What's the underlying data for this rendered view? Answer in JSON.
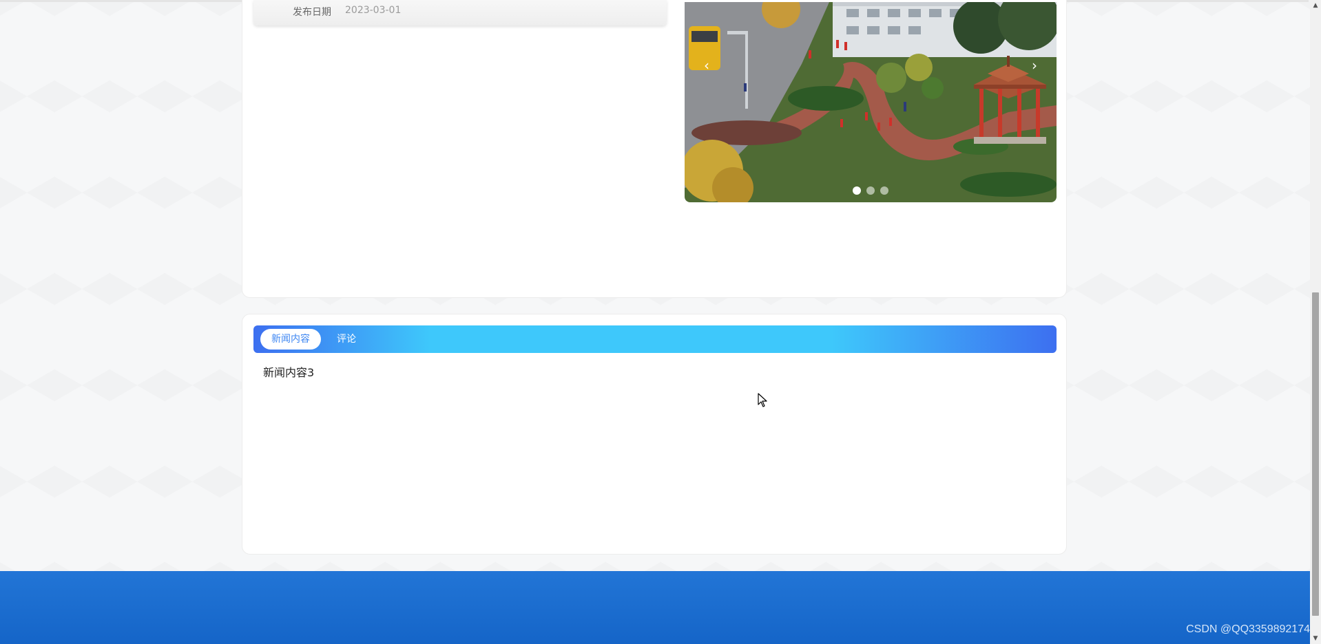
{
  "news_detail": {
    "publish_date_label": "发布日期",
    "publish_date_value": "2023-03-01"
  },
  "carousel": {
    "prev_icon": "‹",
    "next_icon": "›",
    "slide_count": 3,
    "active_slide": 1
  },
  "tabs": {
    "items": [
      {
        "label": "新闻内容",
        "active": true
      },
      {
        "label": "评论",
        "active": false
      }
    ]
  },
  "content": {
    "body": "新闻内容3"
  },
  "footer": {
    "watermark": "CSDN @QQ3359892174"
  },
  "colors": {
    "primary": "#3d6ff0",
    "accent": "#3ec8fb",
    "footer": "#1a6dd0"
  }
}
